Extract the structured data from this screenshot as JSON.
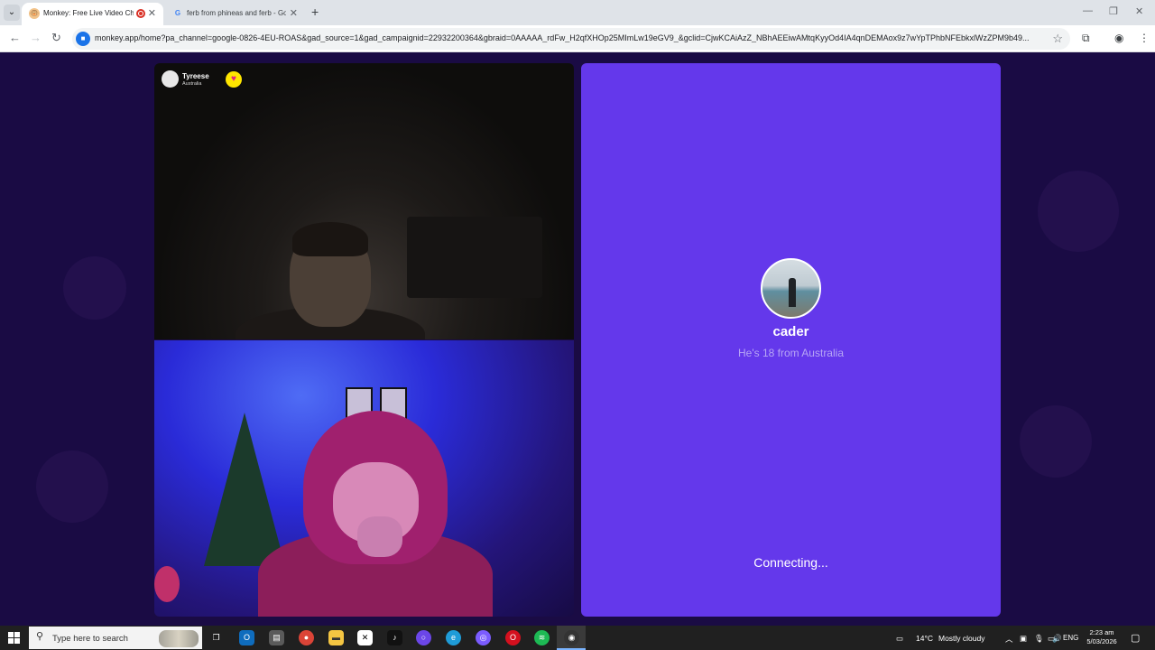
{
  "browser": {
    "tabs": [
      {
        "title": "Monkey: Free Live Video Chat",
        "favicon": "monkey-icon",
        "active": true
      },
      {
        "title": "ferb from phineas and ferb - Google Search",
        "favicon": "google-icon",
        "active": false
      }
    ],
    "url": "monkey.app/home?pa_channel=google-0826-4EU-ROAS&gad_source=1&gad_campaignid=22932200364&gbraid=0AAAAA_rdFw_H2qfXHOp25MImLw19eGV9_&gclid=CjwKCAiAzZ_NBhAEEiwAMtqKyyOd4IA4qnDEMAox9z7wYpTPhbNFEbkxlWzZPM9b49..."
  },
  "call": {
    "caller": {
      "name": "Tyreese",
      "country": "Australia"
    },
    "match": {
      "name": "cader",
      "subtitle": "He's 18 from Australia",
      "status": "Connecting..."
    }
  },
  "colors": {
    "page_bg": "#1a0b44",
    "match_panel": "#6438eb",
    "heart_button": "#ffe600"
  },
  "taskbar": {
    "search_placeholder": "Type here to search",
    "weather_temp": "14°C",
    "weather_desc": "Mostly cloudy",
    "language": "ENG",
    "time": "2:23 am",
    "date": "5/03/2026"
  }
}
